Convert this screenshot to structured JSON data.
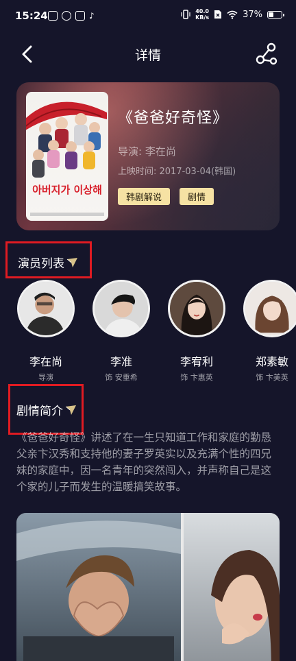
{
  "status_bar": {
    "time": "15:24",
    "speed_value": "40.0",
    "speed_unit": "KB/s",
    "battery_text": "37%",
    "battery_level": 0.37,
    "left_icons": [
      "notification-icon",
      "app-icon",
      "app-icon-2",
      "tiktok-icon"
    ],
    "tiktok_glyph": "♪"
  },
  "header": {
    "title": "详情"
  },
  "drama": {
    "title": "《爸爸好奇怪》",
    "director": "导演: 李在尚",
    "release": "上映时间: 2017-03-04(韩国)",
    "tags": [
      "韩剧解说",
      "剧情"
    ],
    "poster_text": "아버지가 이상해"
  },
  "cast_section": {
    "title": "演员列表"
  },
  "cast": [
    {
      "name": "李在尚",
      "role": "导演"
    },
    {
      "name": "李准",
      "role": "饰 安重希"
    },
    {
      "name": "李宥利",
      "role": "饰 卞惠英"
    },
    {
      "name": "郑素敏",
      "role": "饰 卞美英"
    }
  ],
  "synopsis_section": {
    "title": "剧情简介"
  },
  "synopsis": {
    "text": "《爸爸好奇怪》讲述了在一生只知道工作和家庭的勤恳父亲卞汉秀和支持他的妻子罗英实以及充满个性的四兄妹的家庭中，因一名青年的突然闯入，并声称自己是这个家的儿子而发生的温暖搞笑故事。"
  },
  "colors": {
    "background": "#15152a",
    "tag_background": "#f6e2a3",
    "highlight_box": "#e01b22"
  }
}
